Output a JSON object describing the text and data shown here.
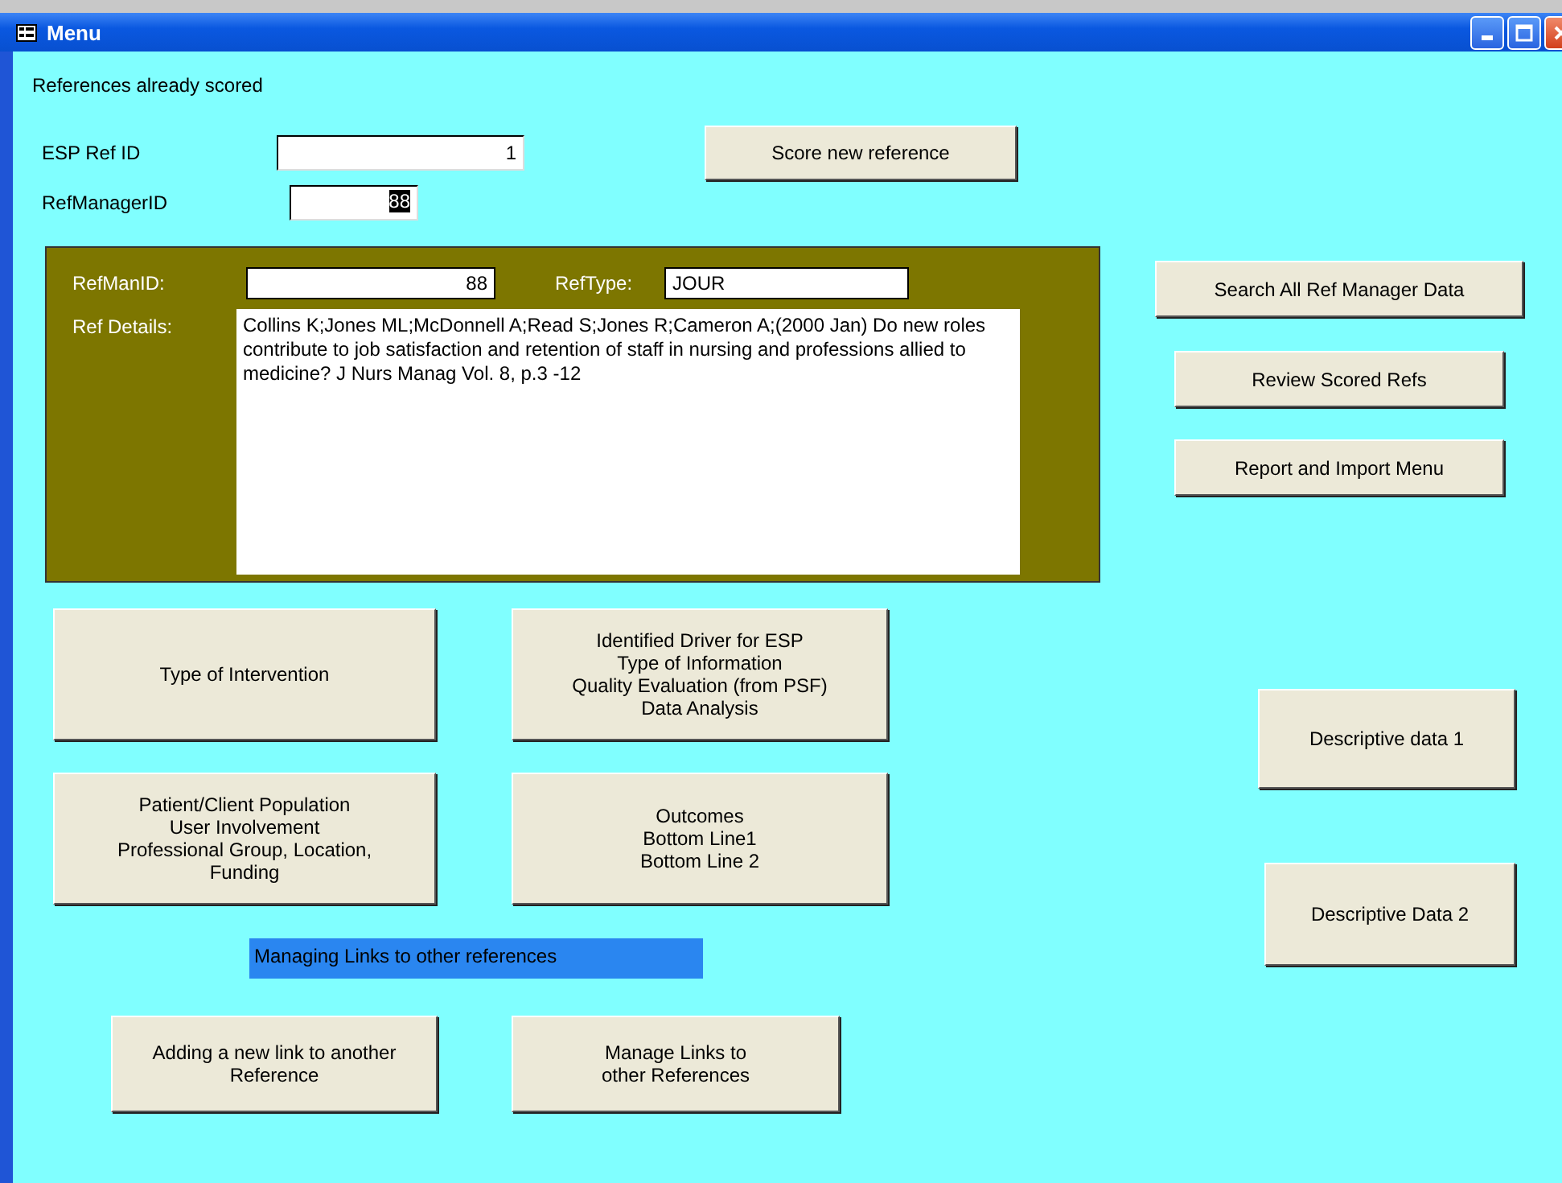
{
  "window": {
    "title": "Menu"
  },
  "heading": "References already scored",
  "esp_ref_id": {
    "label": "ESP Ref ID",
    "value": "1"
  },
  "score_button": "Score new reference",
  "ref_manager_id": {
    "label": "RefManagerID",
    "value": "88",
    "highlighted": true
  },
  "details_panel": {
    "refmanid_label": "RefManID:",
    "refmanid_value": "88",
    "reftype_label": "RefType:",
    "reftype_value": "JOUR",
    "details_label": "Ref Details:",
    "details_value": "Collins K;Jones ML;McDonnell A;Read S;Jones R;Cameron A;(2000 Jan) Do new roles contribute to job satisfaction and retention of staff in nursing and professions allied to medicine? J Nurs Manag Vol. 8, p.3 -12"
  },
  "side_buttons": [
    "Search All Ref Manager Data",
    "Review Scored Refs",
    "Report and Import Menu"
  ],
  "section_buttons": [
    {
      "lines": [
        "Type of Intervention"
      ]
    },
    {
      "lines": [
        "Identified Driver for ESP",
        "Type of Information",
        "Quality Evaluation (from PSF)",
        "Data Analysis"
      ]
    },
    {
      "lines": [
        "Patient/Client Population",
        "User Involvement",
        "Professional Group, Location,",
        "Funding"
      ]
    },
    {
      "lines": [
        "Outcomes",
        "Bottom Line1",
        "Bottom Line 2"
      ]
    }
  ],
  "links_label": "Managing Links to other references",
  "link_buttons": [
    {
      "lines": [
        "Adding a new link to another",
        "Reference"
      ]
    },
    {
      "lines": [
        "Manage Links to",
        "other References"
      ]
    }
  ],
  "descriptive_buttons": [
    "Descriptive data 1",
    "Descriptive Data 2"
  ]
}
